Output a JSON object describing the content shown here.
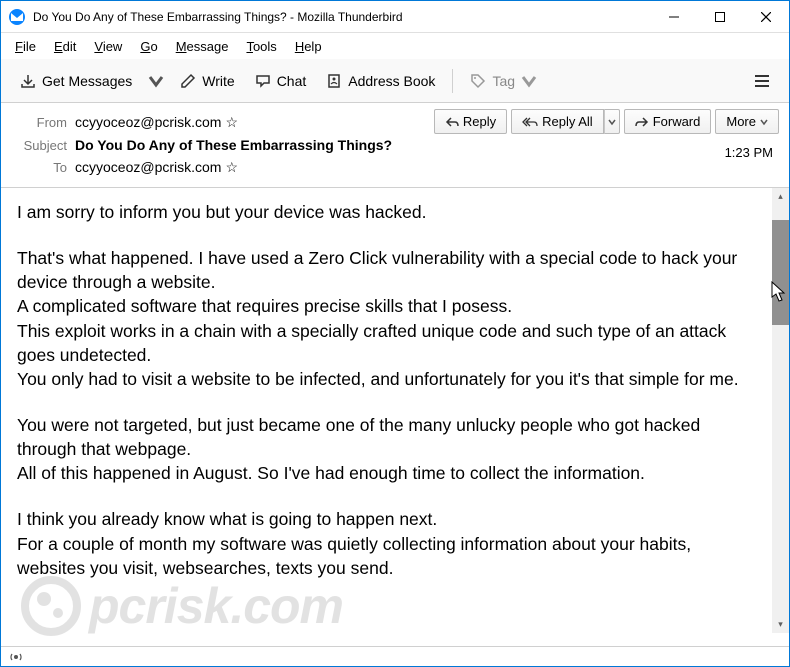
{
  "titlebar": {
    "title": "Do You Do Any of These Embarrassing Things? - Mozilla Thunderbird"
  },
  "menubar": {
    "file": "File",
    "edit": "Edit",
    "view": "View",
    "go": "Go",
    "message": "Message",
    "tools": "Tools",
    "help": "Help"
  },
  "toolbar": {
    "get_messages": "Get Messages",
    "write": "Write",
    "chat": "Chat",
    "address_book": "Address Book",
    "tag": "Tag"
  },
  "headers": {
    "from_label": "From",
    "from_value": "ccyyoceoz@pcrisk.com",
    "subject_label": "Subject",
    "subject_value": "Do You Do Any of These Embarrassing Things?",
    "to_label": "To",
    "to_value": "ccyyoceoz@pcrisk.com",
    "time": "1:23 PM"
  },
  "actions": {
    "reply": "Reply",
    "reply_all": "Reply All",
    "forward": "Forward",
    "more": "More"
  },
  "body": {
    "p1": "I am sorry to inform you but your device was hacked.",
    "p2": "That's what happened. I have used a Zero Click vulnerability with a special code to hack your device through a website.\nA complicated software that requires precise skills that I posess.\nThis exploit works in a chain with a specially crafted unique code and such type of an attack goes undetected.\nYou only had to visit a website to be infected, and unfortunately for you it's that simple for me.",
    "p3": "You were not targeted, but just became one of the many unlucky people who got hacked through that webpage.\nAll of this happened in August. So I've had enough time to collect the information.",
    "p4": "I think you already know what is going to happen next.\nFor a couple of month my software was quietly collecting information about your habits, websites you visit, websearches, texts you send."
  },
  "watermark": "pcrisk.com"
}
